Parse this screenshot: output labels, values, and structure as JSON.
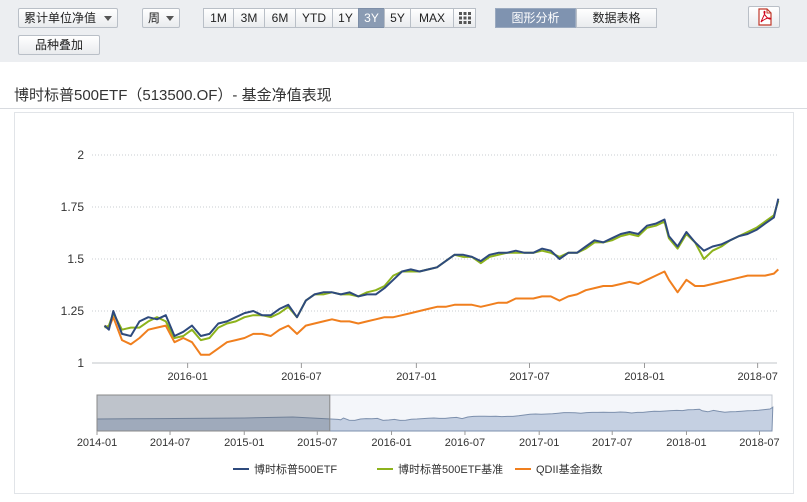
{
  "toolbar": {
    "metric_select": "累计单位净值",
    "period_select": "周",
    "ranges": [
      "1M",
      "3M",
      "6M",
      "YTD",
      "1Y",
      "3Y",
      "5Y",
      "MAX"
    ],
    "active_range": "3Y",
    "view_tabs": [
      "图形分析",
      "数据表格"
    ],
    "active_view": "图形分析",
    "overlay_button": "品种叠加",
    "pdf_icon": "pdf-export-icon",
    "grid_icon": "grid-view-icon"
  },
  "title": "博时标普500ETF（513500.OF）- 基金净值表现",
  "colors": {
    "fund": "#2e4a7d",
    "benchmark": "#8db31c",
    "index": "#f07f1e"
  },
  "chart_data": {
    "type": "line",
    "ylim": [
      1,
      2
    ],
    "y_ticks": [
      "2",
      "1.75",
      "1.5",
      "1.25",
      "1"
    ],
    "x_ticks": [
      "2016-01",
      "2016-07",
      "2017-01",
      "2017-07",
      "2018-01",
      "2018-07"
    ],
    "x_range": [
      "2015-08",
      "2018-08"
    ],
    "series": [
      {
        "name": "博时标普500ETF",
        "x": [
          "2015-08-21",
          "2015-08-28",
          "2015-09-04",
          "2015-09-18",
          "2015-10-02",
          "2015-10-16",
          "2015-10-30",
          "2015-11-13",
          "2015-11-27",
          "2015-12-11",
          "2015-12-25",
          "2016-01-08",
          "2016-01-22",
          "2016-02-05",
          "2016-02-19",
          "2016-03-04",
          "2016-03-18",
          "2016-04-01",
          "2016-04-15",
          "2016-04-29",
          "2016-05-13",
          "2016-05-27",
          "2016-06-10",
          "2016-06-24",
          "2016-07-08",
          "2016-07-22",
          "2016-08-05",
          "2016-08-19",
          "2016-09-02",
          "2016-09-16",
          "2016-09-30",
          "2016-10-14",
          "2016-10-28",
          "2016-11-11",
          "2016-11-25",
          "2016-12-09",
          "2016-12-23",
          "2017-01-06",
          "2017-01-20",
          "2017-02-03",
          "2017-02-17",
          "2017-03-03",
          "2017-03-17",
          "2017-03-31",
          "2017-04-14",
          "2017-04-28",
          "2017-05-12",
          "2017-05-26",
          "2017-06-09",
          "2017-06-23",
          "2017-07-07",
          "2017-07-21",
          "2017-08-04",
          "2017-08-18",
          "2017-09-01",
          "2017-09-15",
          "2017-09-29",
          "2017-10-13",
          "2017-10-27",
          "2017-11-10",
          "2017-11-24",
          "2017-12-08",
          "2017-12-22",
          "2018-01-05",
          "2018-01-19",
          "2018-02-02",
          "2018-02-09",
          "2018-02-23",
          "2018-03-09",
          "2018-03-23",
          "2018-04-06",
          "2018-04-20",
          "2018-05-04",
          "2018-05-18",
          "2018-06-01",
          "2018-06-15",
          "2018-06-29",
          "2018-07-13",
          "2018-07-27",
          "2018-08-03"
        ],
        "values": [
          1.18,
          1.16,
          1.25,
          1.14,
          1.13,
          1.2,
          1.22,
          1.21,
          1.23,
          1.13,
          1.15,
          1.18,
          1.13,
          1.14,
          1.19,
          1.2,
          1.22,
          1.24,
          1.25,
          1.23,
          1.23,
          1.26,
          1.28,
          1.22,
          1.3,
          1.33,
          1.34,
          1.34,
          1.33,
          1.34,
          1.32,
          1.33,
          1.33,
          1.36,
          1.4,
          1.44,
          1.45,
          1.44,
          1.45,
          1.46,
          1.49,
          1.52,
          1.52,
          1.51,
          1.49,
          1.52,
          1.53,
          1.53,
          1.54,
          1.53,
          1.53,
          1.55,
          1.54,
          1.5,
          1.53,
          1.53,
          1.56,
          1.59,
          1.58,
          1.6,
          1.62,
          1.63,
          1.62,
          1.66,
          1.67,
          1.69,
          1.61,
          1.56,
          1.63,
          1.58,
          1.54,
          1.56,
          1.57,
          1.59,
          1.61,
          1.62,
          1.64,
          1.67,
          1.7,
          1.79
        ]
      },
      {
        "name": "博时标普500ETF基准",
        "x": [
          "2015-08-21",
          "2015-08-28",
          "2015-09-04",
          "2015-09-18",
          "2015-10-02",
          "2015-10-16",
          "2015-10-30",
          "2015-11-13",
          "2015-11-27",
          "2015-12-11",
          "2015-12-25",
          "2016-01-08",
          "2016-01-22",
          "2016-02-05",
          "2016-02-19",
          "2016-03-04",
          "2016-03-18",
          "2016-04-01",
          "2016-04-15",
          "2016-04-29",
          "2016-05-13",
          "2016-05-27",
          "2016-06-10",
          "2016-06-24",
          "2016-07-08",
          "2016-07-22",
          "2016-08-05",
          "2016-08-19",
          "2016-09-02",
          "2016-09-16",
          "2016-09-30",
          "2016-10-14",
          "2016-10-28",
          "2016-11-11",
          "2016-11-25",
          "2016-12-09",
          "2016-12-23",
          "2017-01-06",
          "2017-01-20",
          "2017-02-03",
          "2017-02-17",
          "2017-03-03",
          "2017-03-17",
          "2017-03-31",
          "2017-04-14",
          "2017-04-28",
          "2017-05-12",
          "2017-05-26",
          "2017-06-09",
          "2017-06-23",
          "2017-07-07",
          "2017-07-21",
          "2017-08-04",
          "2017-08-18",
          "2017-09-01",
          "2017-09-15",
          "2017-09-29",
          "2017-10-13",
          "2017-10-27",
          "2017-11-10",
          "2017-11-24",
          "2017-12-08",
          "2017-12-22",
          "2018-01-05",
          "2018-01-19",
          "2018-02-02",
          "2018-02-09",
          "2018-02-23",
          "2018-03-09",
          "2018-03-23",
          "2018-04-06",
          "2018-04-20",
          "2018-05-04",
          "2018-05-18",
          "2018-06-01",
          "2018-06-15",
          "2018-06-29",
          "2018-07-13",
          "2018-07-27",
          "2018-08-03"
        ],
        "values": [
          1.17,
          1.18,
          1.24,
          1.16,
          1.17,
          1.17,
          1.2,
          1.22,
          1.2,
          1.12,
          1.13,
          1.16,
          1.11,
          1.12,
          1.17,
          1.19,
          1.2,
          1.22,
          1.23,
          1.23,
          1.22,
          1.24,
          1.27,
          1.22,
          1.3,
          1.33,
          1.33,
          1.34,
          1.33,
          1.33,
          1.32,
          1.34,
          1.35,
          1.37,
          1.42,
          1.44,
          1.44,
          1.44,
          1.45,
          1.46,
          1.49,
          1.52,
          1.51,
          1.51,
          1.48,
          1.51,
          1.52,
          1.53,
          1.53,
          1.53,
          1.53,
          1.54,
          1.53,
          1.51,
          1.53,
          1.53,
          1.55,
          1.58,
          1.58,
          1.59,
          1.61,
          1.62,
          1.61,
          1.65,
          1.66,
          1.68,
          1.6,
          1.55,
          1.62,
          1.58,
          1.5,
          1.54,
          1.56,
          1.59,
          1.61,
          1.63,
          1.65,
          1.68,
          1.71,
          1.78
        ]
      },
      {
        "name": "QDII基金指数",
        "x": [
          "2015-08-21",
          "2015-08-28",
          "2015-09-04",
          "2015-09-18",
          "2015-10-02",
          "2015-10-16",
          "2015-10-30",
          "2015-11-13",
          "2015-11-27",
          "2015-12-11",
          "2015-12-25",
          "2016-01-08",
          "2016-01-22",
          "2016-02-05",
          "2016-02-19",
          "2016-03-04",
          "2016-03-18",
          "2016-04-01",
          "2016-04-15",
          "2016-04-29",
          "2016-05-13",
          "2016-05-27",
          "2016-06-10",
          "2016-06-24",
          "2016-07-08",
          "2016-07-22",
          "2016-08-05",
          "2016-08-19",
          "2016-09-02",
          "2016-09-16",
          "2016-09-30",
          "2016-10-14",
          "2016-10-28",
          "2016-11-11",
          "2016-11-25",
          "2016-12-09",
          "2016-12-23",
          "2017-01-06",
          "2017-01-20",
          "2017-02-03",
          "2017-02-17",
          "2017-03-03",
          "2017-03-17",
          "2017-03-31",
          "2017-04-14",
          "2017-04-28",
          "2017-05-12",
          "2017-05-26",
          "2017-06-09",
          "2017-06-23",
          "2017-07-07",
          "2017-07-21",
          "2017-08-04",
          "2017-08-18",
          "2017-09-01",
          "2017-09-15",
          "2017-09-29",
          "2017-10-13",
          "2017-10-27",
          "2017-11-10",
          "2017-11-24",
          "2017-12-08",
          "2017-12-22",
          "2018-01-05",
          "2018-01-19",
          "2018-02-02",
          "2018-02-09",
          "2018-02-23",
          "2018-03-09",
          "2018-03-23",
          "2018-04-06",
          "2018-04-20",
          "2018-05-04",
          "2018-05-18",
          "2018-06-01",
          "2018-06-15",
          "2018-06-29",
          "2018-07-13",
          "2018-07-27",
          "2018-08-03"
        ],
        "values": [
          1.18,
          1.17,
          1.22,
          1.11,
          1.09,
          1.12,
          1.16,
          1.17,
          1.18,
          1.1,
          1.12,
          1.1,
          1.04,
          1.04,
          1.07,
          1.1,
          1.11,
          1.12,
          1.14,
          1.14,
          1.13,
          1.16,
          1.18,
          1.14,
          1.18,
          1.19,
          1.2,
          1.21,
          1.2,
          1.2,
          1.19,
          1.2,
          1.21,
          1.22,
          1.22,
          1.23,
          1.24,
          1.25,
          1.26,
          1.27,
          1.27,
          1.28,
          1.28,
          1.28,
          1.27,
          1.28,
          1.29,
          1.29,
          1.31,
          1.31,
          1.31,
          1.32,
          1.32,
          1.3,
          1.32,
          1.33,
          1.35,
          1.36,
          1.37,
          1.37,
          1.38,
          1.39,
          1.38,
          1.4,
          1.42,
          1.44,
          1.4,
          1.34,
          1.4,
          1.37,
          1.37,
          1.38,
          1.39,
          1.4,
          1.41,
          1.42,
          1.42,
          1.42,
          1.43,
          1.45
        ]
      }
    ],
    "navigator": {
      "x_ticks": [
        "2014-01",
        "2014-07",
        "2015-01",
        "2015-07",
        "2016-01",
        "2016-07",
        "2017-01",
        "2017-07",
        "2018-01",
        "2018-07"
      ],
      "selected_from": "2014-01",
      "selected_to": "2015-08"
    },
    "legend_position": "bottom-center"
  }
}
